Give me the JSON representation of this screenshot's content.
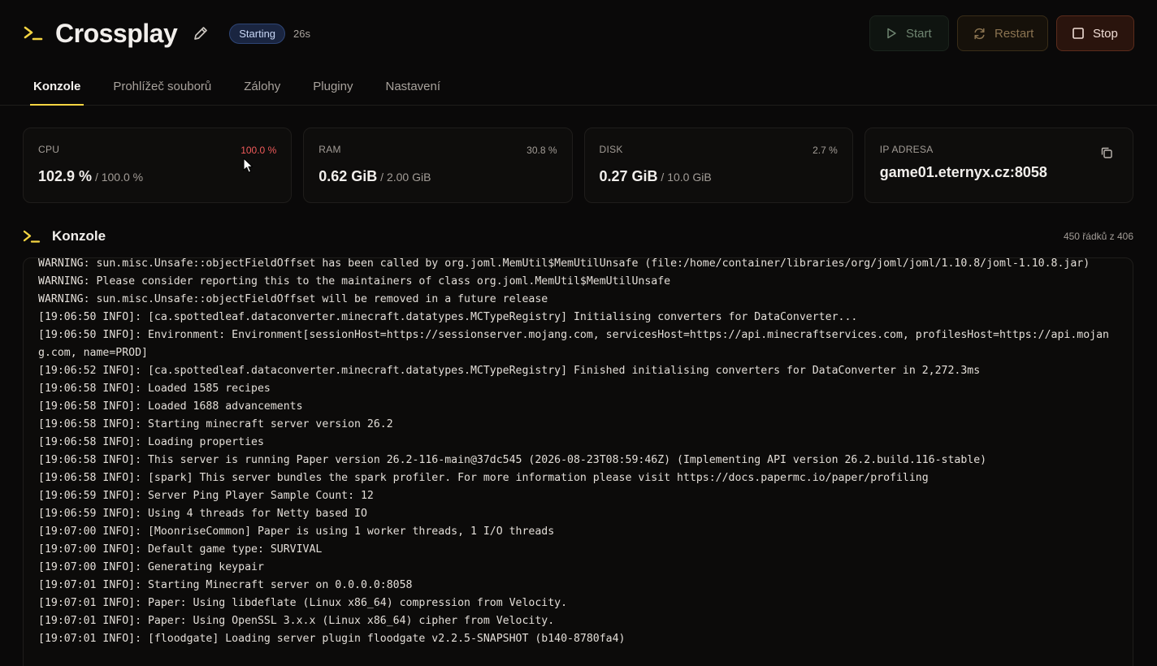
{
  "header": {
    "title": "Crossplay",
    "status": "Starting",
    "uptime": "26s",
    "buttons": {
      "start": "Start",
      "restart": "Restart",
      "stop": "Stop"
    }
  },
  "tabs": [
    {
      "label": "Konzole",
      "active": true
    },
    {
      "label": "Prohlížeč souborů",
      "active": false
    },
    {
      "label": "Zálohy",
      "active": false
    },
    {
      "label": "Pluginy",
      "active": false
    },
    {
      "label": "Nastavení",
      "active": false
    }
  ],
  "stats": {
    "cpu": {
      "label": "CPU",
      "percent": "100.0 %",
      "value": "102.9 %",
      "limit": " / 100.0 %"
    },
    "ram": {
      "label": "RAM",
      "percent": "30.8 %",
      "value": "0.62 GiB",
      "limit": " / 2.00 GiB"
    },
    "disk": {
      "label": "DISK",
      "percent": "2.7 %",
      "value": "0.27 GiB",
      "limit": " / 10.0 GiB"
    },
    "ip": {
      "label": "IP ADRESA",
      "value": "game01.eternyx.cz:8058"
    }
  },
  "console": {
    "title": "Konzole",
    "line_count": "450 řádků z 406",
    "lines": [
      "WARNING: sun.misc.Unsafe::objectFieldOffset has been called by org.joml.MemUtil$MemUtilUnsafe (file:/home/container/libraries/org/joml/joml/1.10.8/joml-1.10.8.jar)",
      "WARNING: Please consider reporting this to the maintainers of class org.joml.MemUtil$MemUtilUnsafe",
      "WARNING: sun.misc.Unsafe::objectFieldOffset will be removed in a future release",
      "[19:06:50 INFO]: [ca.spottedleaf.dataconverter.minecraft.datatypes.MCTypeRegistry] Initialising converters for DataConverter...",
      "[19:06:50 INFO]: Environment: Environment[sessionHost=https://sessionserver.mojang.com, servicesHost=https://api.minecraftservices.com, profilesHost=https://api.mojang.com, name=PROD]",
      "[19:06:52 INFO]: [ca.spottedleaf.dataconverter.minecraft.datatypes.MCTypeRegistry] Finished initialising converters for DataConverter in 2,272.3ms",
      "[19:06:58 INFO]: Loaded 1585 recipes",
      "[19:06:58 INFO]: Loaded 1688 advancements",
      "[19:06:58 INFO]: Starting minecraft server version 26.2",
      "[19:06:58 INFO]: Loading properties",
      "[19:06:58 INFO]: This server is running Paper version 26.2-116-main@37dc545 (2026-08-23T08:59:46Z) (Implementing API version 26.2.build.116-stable)",
      "[19:06:58 INFO]: [spark] This server bundles the spark profiler. For more information please visit https://docs.papermc.io/paper/profiling",
      "[19:06:59 INFO]: Server Ping Player Sample Count: 12",
      "[19:06:59 INFO]: Using 4 threads for Netty based IO",
      "[19:07:00 INFO]: [MoonriseCommon] Paper is using 1 worker threads, 1 I/O threads",
      "[19:07:00 INFO]: Default game type: SURVIVAL",
      "[19:07:00 INFO]: Generating keypair",
      "[19:07:01 INFO]: Starting Minecraft server on 0.0.0.0:8058",
      "[19:07:01 INFO]: Paper: Using libdeflate (Linux x86_64) compression from Velocity.",
      "[19:07:01 INFO]: Paper: Using OpenSSL 3.x.x (Linux x86_64) cipher from Velocity.",
      "[19:07:01 INFO]: [floodgate] Loading server plugin floodgate v2.2.5-SNAPSHOT (b140-8780fa4)"
    ]
  },
  "colors": {
    "accent": "#f5d542",
    "alert": "#ef5a5a",
    "status_badge": "#1a2540"
  }
}
